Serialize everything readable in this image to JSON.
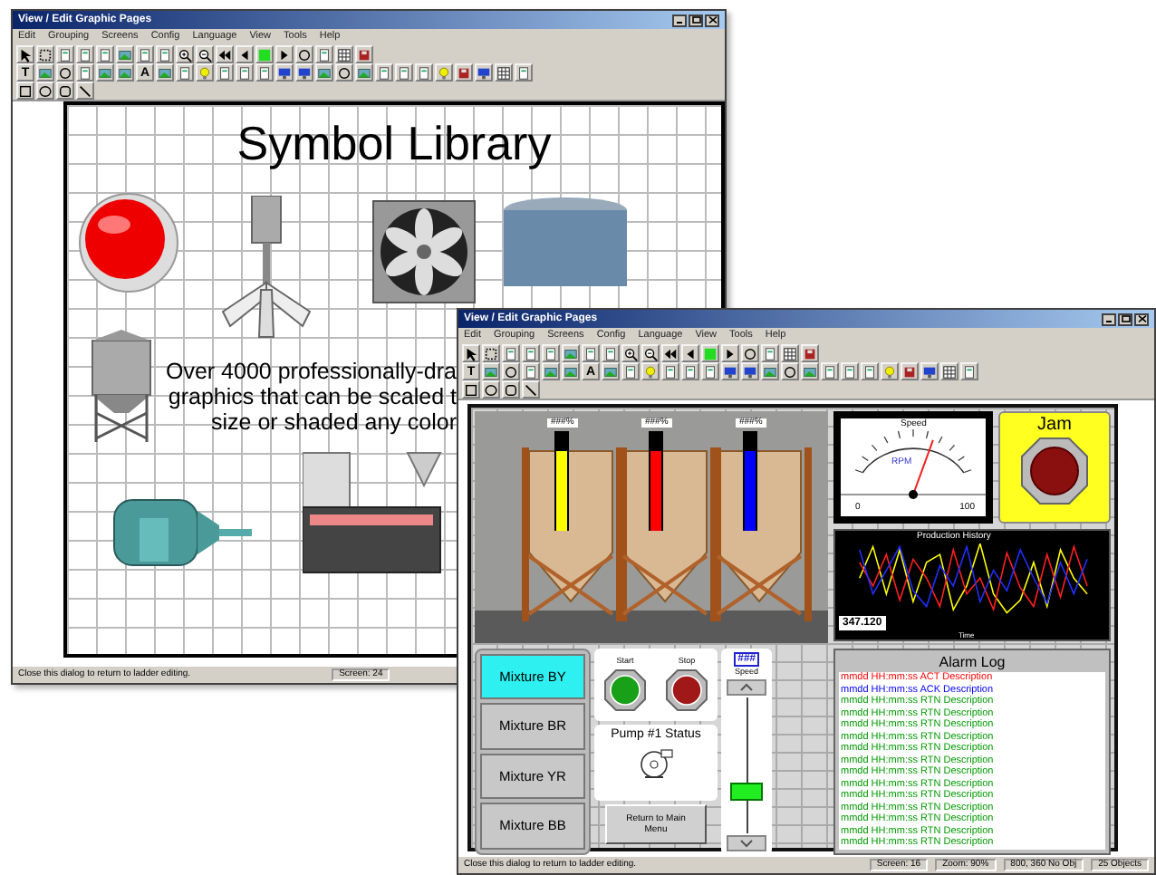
{
  "windows": [
    {
      "title": "View / Edit Graphic Pages",
      "menu": [
        "Edit",
        "Grouping",
        "Screens",
        "Config",
        "Language",
        "View",
        "Tools",
        "Help"
      ],
      "text_tool": "T",
      "font_tool": "A",
      "canvas": {
        "kind": "library",
        "title": "Symbol Library",
        "blurb": [
          "Over 4000 professionally-dra",
          "graphics that can be scaled t",
          "size or shaded any color"
        ]
      },
      "status_bar": {
        "message": "Close this dialog to return to ladder editing.",
        "fields": [
          "Screen: 24"
        ]
      }
    },
    {
      "title": "View / Edit Graphic Pages",
      "menu": [
        "Edit",
        "Grouping",
        "Screens",
        "Config",
        "Language",
        "View",
        "Tools",
        "Help"
      ],
      "text_tool": "T",
      "font_tool": "A",
      "canvas": {
        "kind": "hmi",
        "tanks": [
          {
            "label": "###%",
            "color": "#ffff00",
            "level": 0.8
          },
          {
            "label": "###%",
            "color": "#ff0000",
            "level": 0.8
          },
          {
            "label": "###%",
            "color": "#0000ff",
            "level": 0.8
          }
        ],
        "gauge": {
          "title": "Speed",
          "unit": "RPM",
          "min": "0",
          "max": "100"
        },
        "jam": {
          "label": "Jam"
        },
        "chart": {
          "title": "Production History",
          "readout": "347.120",
          "xlabel": "Time"
        },
        "mixtures": [
          {
            "label": "Mixture BY",
            "selected": true
          },
          {
            "label": "Mixture BR",
            "selected": false
          },
          {
            "label": "Mixture YR",
            "selected": false
          },
          {
            "label": "Mixture BB",
            "selected": false
          }
        ],
        "start": "Start",
        "stop": "Stop",
        "pump": "Pump #1 Status",
        "return_button": "Return to Main Menu",
        "speed": {
          "display": "###",
          "label": "Speed",
          "level": 0.3
        },
        "alarm_log": {
          "title": "Alarm Log",
          "rows": [
            {
              "text": "mmdd HH:mm:ss ACT Description",
              "color": "#ff0000"
            },
            {
              "text": "mmdd HH:mm:ss ACK Description",
              "color": "#0000ff"
            },
            {
              "text": "mmdd HH:mm:ss RTN Description",
              "color": "#009900"
            },
            {
              "text": "mmdd HH:mm:ss RTN Description",
              "color": "#009900"
            },
            {
              "text": "mmdd HH:mm:ss RTN Description",
              "color": "#009900"
            },
            {
              "text": "mmdd HH:mm:ss RTN Description",
              "color": "#009900"
            },
            {
              "text": "mmdd HH:mm:ss RTN Description",
              "color": "#009900"
            },
            {
              "text": "mmdd HH:mm:ss RTN Description",
              "color": "#009900"
            },
            {
              "text": "mmdd HH:mm:ss RTN Description",
              "color": "#009900"
            },
            {
              "text": "mmdd HH:mm:ss RTN Description",
              "color": "#009900"
            },
            {
              "text": "mmdd HH:mm:ss RTN Description",
              "color": "#009900"
            },
            {
              "text": "mmdd HH:mm:ss RTN Description",
              "color": "#009900"
            },
            {
              "text": "mmdd HH:mm:ss RTN Description",
              "color": "#009900"
            },
            {
              "text": "mmdd HH:mm:ss RTN Description",
              "color": "#009900"
            },
            {
              "text": "mmdd HH:mm:ss RTN Description",
              "color": "#009900"
            }
          ]
        }
      },
      "status_bar": {
        "message": "Close this dialog to return to ladder editing.",
        "fields": [
          "Screen: 16",
          "Zoom: 90%",
          "800, 360 No Obj",
          "25 Objects"
        ]
      }
    }
  ]
}
